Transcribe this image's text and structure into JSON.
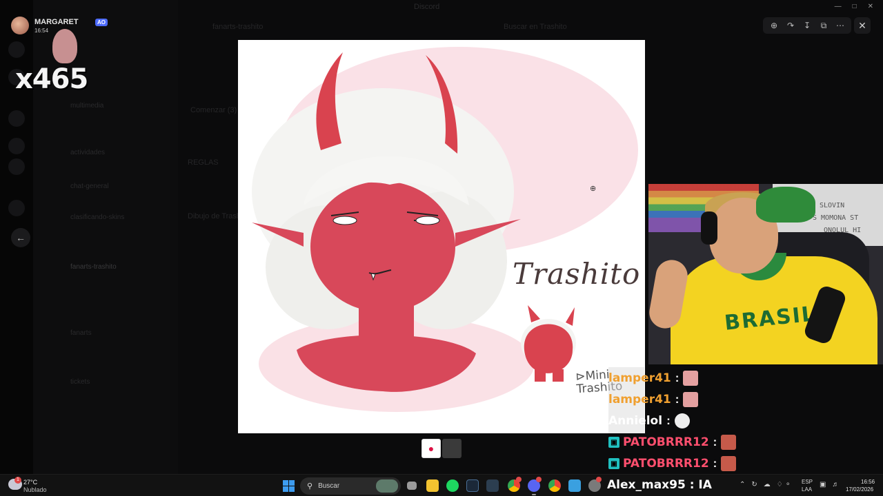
{
  "background_app": {
    "window_title": "Discord",
    "channel_header": "fanarts-trashito",
    "search_placeholder": "Buscar en Trashito",
    "channels": [
      "multimedia",
      "actividades",
      "chat-general",
      "clasificando-skins",
      "fanarts-trashito",
      "tickets",
      "fanarts"
    ],
    "main_texts": [
      "REGLAS",
      "Dibujo de Trashito",
      "Comenzar (3)"
    ]
  },
  "overlay_user": {
    "name": "MARGARET",
    "badge": "AO",
    "time": "16:54",
    "combo": "x465"
  },
  "viewer": {
    "toolbar_icons": [
      "zoom-in-icon",
      "share-icon",
      "download-icon",
      "open-external-icon",
      "more-icon"
    ],
    "close_icon": "close-icon",
    "back_icon": "arrow-left-icon"
  },
  "artwork": {
    "title": "Trashito",
    "subtitle_line1": "Mini",
    "subtitle_line2": "Trashito",
    "subtitle_arrow": "⊳"
  },
  "webcam": {
    "shirt_text": "BRASIL",
    "wall_text_1": "SLOVIN",
    "wall_text_2": "S MOMONA ST",
    "wall_text_3": "ONOLUL HI"
  },
  "chat": [
    {
      "user": "lamper41",
      "color": "#f0a030",
      "emote": "#e4a0a0",
      "badge": false
    },
    {
      "user": "lamper41",
      "color": "#f0a030",
      "emote": "#e4a0a0",
      "badge": false
    },
    {
      "user": "Annielol",
      "color": "#ffffff",
      "emote": "#eeeeee",
      "badge": false
    },
    {
      "user": "PATOBRRR12",
      "color": "#ff4f6e",
      "emote": "#c65a4a",
      "badge": true
    },
    {
      "user": "PATOBRRR12",
      "color": "#ff4f6e",
      "emote": "#c65a4a",
      "badge": true
    }
  ],
  "taskbar": {
    "weather_temp": "27°C",
    "weather_desc": "Nublado",
    "weather_badge": "1",
    "search_label": "Buscar",
    "overlay_chat_line": "Alex_max95 : IA",
    "lang_top": "ESP",
    "lang_bottom": "LAA",
    "time": "16:56",
    "date": "17/02/2026",
    "apps": [
      "task-view-icon",
      "file-explorer-icon",
      "spotify-icon",
      "steam-icon",
      "terminal-icon",
      "chrome-icon",
      "discord-icon",
      "chrome-icon",
      "notepad-icon",
      "settings-icon"
    ]
  }
}
